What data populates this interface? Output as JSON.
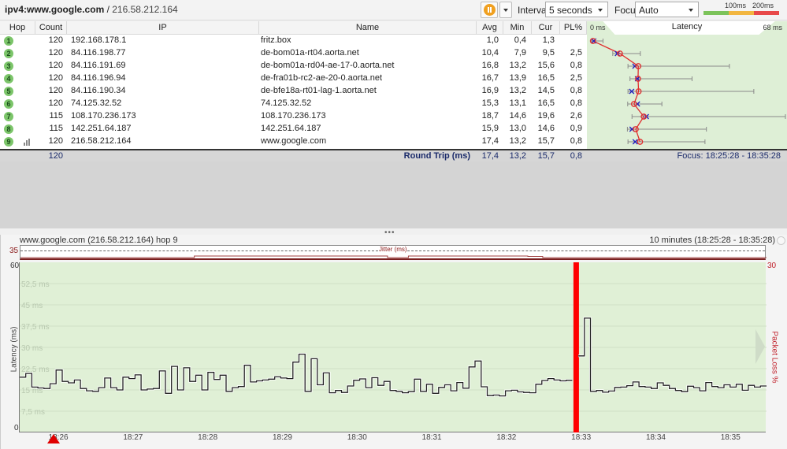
{
  "toolbar": {
    "target_host": "ipv4:www.google.com",
    "target_sep": " / ",
    "target_ip": "216.58.212.164",
    "pause_icon": "pause-icon",
    "interval_label": "Interval",
    "interval_value": "5 seconds",
    "focus_label": "Focus",
    "focus_value": "Auto",
    "scale": {
      "t1": "100ms",
      "t2": "200ms",
      "colors": {
        "good": "#7cc35a",
        "warn": "#f2b640",
        "bad": "#e84a4a"
      }
    }
  },
  "table": {
    "headers": {
      "hop": "Hop",
      "count": "Count",
      "ip": "IP",
      "name": "Name",
      "avg": "Avg",
      "min": "Min",
      "cur": "Cur",
      "pl": "PL%",
      "latency": "Latency",
      "lat_min": "0 ms",
      "lat_max": "68 ms"
    },
    "rows": [
      {
        "hop": "1",
        "count": "120",
        "ip": "192.168.178.1",
        "name": "fritz.box",
        "avg": "1,0",
        "min": "0,4",
        "cur": "1,3",
        "pl": "",
        "avgv": 1.0,
        "minv": 0.4,
        "curv": 1.3,
        "maxv": 4.5,
        "plv": 0
      },
      {
        "hop": "2",
        "count": "120",
        "ip": "84.116.198.77",
        "name": "de-bom01a-rt04.aorta.net",
        "avg": "10,4",
        "min": "7,9",
        "cur": "9,5",
        "pl": "2,5",
        "avgv": 10.4,
        "minv": 7.9,
        "curv": 9.5,
        "maxv": 17.5,
        "plv": 2.5
      },
      {
        "hop": "3",
        "count": "120",
        "ip": "84.116.191.69",
        "name": "de-bom01a-rd04-ae-17-0.aorta.net",
        "avg": "16,8",
        "min": "13,2",
        "cur": "15,6",
        "pl": "0,8",
        "avgv": 16.8,
        "minv": 13.2,
        "curv": 15.6,
        "maxv": 48.5,
        "plv": 0.8
      },
      {
        "hop": "4",
        "count": "120",
        "ip": "84.116.196.94",
        "name": "de-fra01b-rc2-ae-20-0.aorta.net",
        "avg": "16,7",
        "min": "13,9",
        "cur": "16,5",
        "pl": "2,5",
        "avgv": 16.7,
        "minv": 13.9,
        "curv": 16.5,
        "maxv": 35.5,
        "plv": 2.5
      },
      {
        "hop": "5",
        "count": "120",
        "ip": "84.116.190.34",
        "name": "de-bfe18a-rt01-lag-1.aorta.net",
        "avg": "16,9",
        "min": "13,2",
        "cur": "14,5",
        "pl": "0,8",
        "avgv": 16.9,
        "minv": 13.2,
        "curv": 14.5,
        "maxv": 57.0,
        "plv": 0.8
      },
      {
        "hop": "6",
        "count": "120",
        "ip": "74.125.32.52",
        "name": "74.125.32.52",
        "avg": "15,3",
        "min": "13,1",
        "cur": "16,5",
        "pl": "0,8",
        "avgv": 15.3,
        "minv": 13.1,
        "curv": 16.5,
        "maxv": 25.0,
        "plv": 0.8
      },
      {
        "hop": "7",
        "count": "115",
        "ip": "108.170.236.173",
        "name": "108.170.236.173",
        "avg": "18,7",
        "min": "14,6",
        "cur": "19,6",
        "pl": "2,6",
        "avgv": 18.7,
        "minv": 14.6,
        "curv": 19.6,
        "maxv": 68.0,
        "plv": 2.6
      },
      {
        "hop": "8",
        "count": "115",
        "ip": "142.251.64.187",
        "name": "142.251.64.187",
        "avg": "15,9",
        "min": "13,0",
        "cur": "14,6",
        "pl": "0,9",
        "avgv": 15.9,
        "minv": 13.0,
        "curv": 14.6,
        "maxv": 40.5,
        "plv": 0.9
      },
      {
        "hop": "9",
        "count": "120",
        "ip": "216.58.212.164",
        "name": "www.google.com",
        "avg": "17,4",
        "min": "13,2",
        "cur": "15,7",
        "pl": "0,8",
        "avgv": 17.4,
        "minv": 13.2,
        "curv": 15.7,
        "maxv": 40.0,
        "plv": 0.8
      }
    ],
    "footer": {
      "count": "120",
      "label": "Round Trip (ms)",
      "avg": "17,4",
      "min": "13,2",
      "cur": "15,7",
      "pl": "0,8",
      "focus": "Focus: 18:25:28 - 18:35:28"
    },
    "latency_scale_max": 68
  },
  "graph": {
    "title": "www.google.com (216.58.212.164) hop 9",
    "range": "10 minutes (18:25:28 - 18:35:28)",
    "jitter_label": "Jitter (ms)",
    "jitter_max": "35"
  },
  "chart_data": {
    "type": "line",
    "title": "www.google.com (216.58.212.164) hop 9",
    "xlabel": "",
    "ylabel": "Latency (ms)",
    "y2label": "Packet Loss %",
    "ylim": [
      0,
      60
    ],
    "y2lim": [
      0,
      30
    ],
    "y_ticks": [
      "0",
      "60"
    ],
    "y2_ticks": [
      "30"
    ],
    "gridlines": [
      "7,5 ms",
      "15 ms",
      "22,5 ms",
      "30 ms",
      "37,5 ms",
      "45 ms",
      "52,5 ms"
    ],
    "grid_values": [
      7.5,
      15,
      22.5,
      30,
      37.5,
      45,
      52.5
    ],
    "x_ticks": [
      "18:26",
      "18:27",
      "18:28",
      "18:29",
      "18:30",
      "18:31",
      "18:32",
      "18:33",
      "18:34",
      "18:35"
    ],
    "x_range_minutes": [
      25.4667,
      35.4667
    ],
    "interval_seconds": 5,
    "series": [
      {
        "name": "Latency (ms)",
        "values": [
          19.5,
          20.8,
          16.0,
          15.7,
          15.5,
          17.2,
          22.0,
          18.0,
          17.5,
          18.5,
          15.5,
          14.7,
          14.5,
          15.8,
          19.2,
          15.8,
          15.0,
          19.5,
          19.0,
          20.3,
          15.0,
          15.3,
          15.5,
          21.7,
          13.8,
          23.3,
          15.0,
          22.8,
          18.0,
          20.2,
          15.0,
          21.2,
          18.7,
          20.2,
          14.5,
          15.8,
          16.2,
          23.7,
          17.8,
          18.2,
          18.5,
          18.8,
          19.6,
          19.2,
          19.0,
          24.8,
          27.6,
          14.5,
          26.0,
          16.8,
          21.0,
          14.0,
          14.8,
          14.1,
          16.4,
          18.4,
          18.9,
          15.8,
          19.3,
          16.6,
          18.0,
          14.8,
          14.5,
          14.0,
          14.4,
          18.8,
          14.5,
          17.0,
          13.8,
          15.9,
          16.8,
          14.7,
          17.6,
          15.6,
          23.1,
          25.2,
          16.1,
          13.0,
          13.2,
          12.9,
          14.7,
          14.9,
          14.3,
          14.1,
          14.0,
          17.0,
          18.3,
          19.0,
          18.5,
          18.2,
          18.4,
          null,
          27.0,
          40.3,
          14.5,
          14.8,
          14.2,
          14.6,
          15.9,
          16.0,
          16.5,
          17.8,
          16.2,
          16.0,
          15.5,
          17.5,
          16.6,
          15.5,
          14.8,
          14.4,
          16.3,
          15.8,
          14.7,
          17.6,
          16.2,
          15.8,
          16.8,
          16.0,
          17.0,
          14.9,
          16.6,
          16.0,
          16.4
        ]
      },
      {
        "name": "Packet Loss %",
        "events": [
          {
            "index": 91,
            "value": 30
          }
        ]
      }
    ],
    "jitter_series": {
      "name": "Jitter (ms)",
      "ylim": [
        0,
        35
      ]
    },
    "focus_marker_time": "18:25:53"
  }
}
